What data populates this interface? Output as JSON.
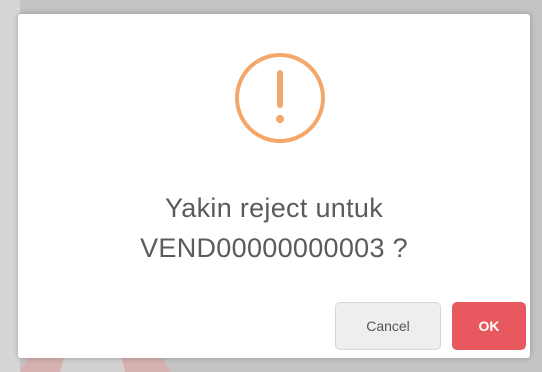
{
  "dialog": {
    "icon": "warning-exclamation-icon",
    "message_line_1": "Yakin reject untuk",
    "message_line_2": "VEND00000000003 ?",
    "cancel_label": "Cancel",
    "ok_label": "OK"
  },
  "colors": {
    "icon_accent": "#f4a76a",
    "ok_button": "#e8585f",
    "cancel_button": "#eeeeee",
    "message_text": "#5b5b5b"
  }
}
